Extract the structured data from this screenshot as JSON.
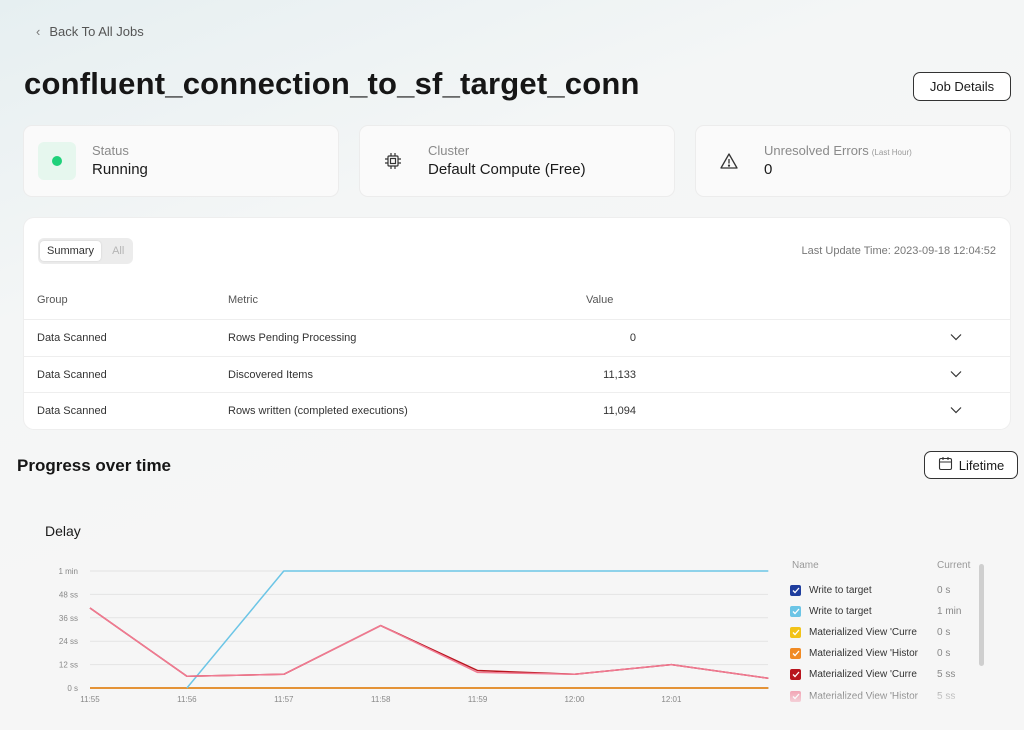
{
  "nav": {
    "back_label": "Back To All Jobs"
  },
  "job": {
    "title": "confluent_connection_to_sf_target_conn",
    "details_button": "Job Details"
  },
  "cards": {
    "status": {
      "label": "Status",
      "value": "Running",
      "icon": "status-dot-icon",
      "color": "#1fd17a"
    },
    "cluster": {
      "label": "Cluster",
      "value": "Default Compute (Free)",
      "icon": "cpu-chip-icon"
    },
    "errors": {
      "label": "Unresolved Errors",
      "sublabel": "(Last Hour)",
      "value": "0",
      "icon": "warning-triangle-icon"
    }
  },
  "metrics": {
    "tabs": [
      {
        "label": "Summary",
        "active": true
      },
      {
        "label": "All",
        "active": false
      }
    ],
    "last_update": "Last Update Time: 2023-09-18 12:04:52",
    "columns": [
      "Group",
      "Metric",
      "Value"
    ],
    "rows": [
      {
        "group": "Data Scanned",
        "metric": "Rows Pending Processing",
        "value": "0"
      },
      {
        "group": "Data Scanned",
        "metric": "Discovered Items",
        "value": "11,133"
      },
      {
        "group": "Data Scanned",
        "metric": "Rows written (completed executions)",
        "value": "11,094"
      }
    ]
  },
  "progress": {
    "title": "Progress over time",
    "range_button": "Lifetime",
    "range_icon": "calendar-icon"
  },
  "chart_data": {
    "type": "line",
    "title": "Delay",
    "x": [
      "11:55",
      "11:56",
      "11:57",
      "11:58",
      "11:59",
      "12:00",
      "12:01",
      ""
    ],
    "y_ticks": [
      "0 s",
      "12 ss",
      "24 ss",
      "36 ss",
      "48 ss",
      "1 min"
    ],
    "ylim": [
      0,
      60
    ],
    "grid": true,
    "legend_position": "right",
    "legend_header": {
      "name": "Name",
      "current": "Current"
    },
    "series": [
      {
        "name": "Write to target",
        "current": "0 s",
        "color": "#1f3e9e",
        "values": [
          0,
          0,
          0,
          0,
          0,
          0,
          0,
          0
        ]
      },
      {
        "name": "Write to target",
        "current": "1 min",
        "color": "#6cc5e6",
        "values": [
          null,
          0,
          60,
          60,
          60,
          60,
          60,
          60
        ]
      },
      {
        "name": "Materialized View 'Curre",
        "current": "0 s",
        "color": "#f2c318",
        "values": [
          0,
          0,
          0,
          0,
          0,
          0,
          0,
          0
        ]
      },
      {
        "name": "Materialized View 'Histor",
        "current": "0 s",
        "color": "#f08a24",
        "values": [
          0,
          0,
          0,
          0,
          0,
          0,
          0,
          0
        ]
      },
      {
        "name": "Materialized View 'Curre",
        "current": "5 ss",
        "color": "#b8141d",
        "values": [
          41,
          6,
          7,
          32,
          9,
          7,
          12,
          5
        ]
      },
      {
        "name": "Materialized View 'Histor",
        "current": "5 ss",
        "color": "#f07a92",
        "values": [
          41,
          6,
          7,
          32,
          8,
          7,
          12,
          5
        ]
      }
    ]
  }
}
